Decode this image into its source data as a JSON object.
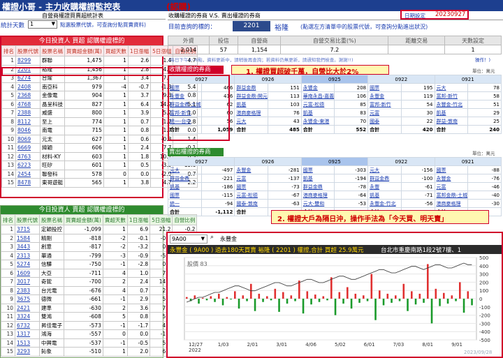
{
  "title_bar": {
    "title": "權證小哥 - 主力收購權證監控表",
    "badge": "(認購)",
    "date_label": "日期設定",
    "date_value": "20230927"
  },
  "left_top": {
    "caption": "自營商權證買賣超統計表",
    "days_label": "統計天數",
    "days_value": "1",
    "hint": "點選股票代號，可查詢分點買賣資料)"
  },
  "right_top": {
    "caption": "收購權證的券商 V.S. 賣出權證的券商",
    "query_label": "目前查詢的標的：",
    "stock_code": "2201",
    "stock_name": "裕隆",
    "hint": "(點選左方清單中的股票代號，可查詢分點進出狀況)"
  },
  "summary": {
    "headers": [
      "外資",
      "投信",
      "自營商",
      "自營交易比重(%)",
      "距離交易",
      "天數設定"
    ],
    "values": [
      "2,014",
      "57",
      "1,154",
      "7.2",
      "",
      "1"
    ],
    "note": "(每日下午4~6點，資料更新中，請稍後再查詢；若資料仍無更新，請通知我們檢查。謝謝!!)",
    "note_tail": "操作！)"
  },
  "buy_table": {
    "title": "今日投資人 買超 認購權證標的",
    "headers": [
      "排名",
      "股票代號",
      "股票名稱",
      "買賣超金額(萬)",
      "買超天數",
      "1日漲幅",
      "5日漲幅",
      "自營比例"
    ],
    "rows": [
      [
        "1",
        "8299",
        "群聯",
        "1,475",
        "1",
        "2.6",
        "1.4",
        "4.7"
      ],
      [
        "2",
        "2201",
        "裕隆",
        "1,456",
        "1",
        "2.8",
        "4.6",
        "7.2"
      ],
      [
        "3",
        "6274",
        "台燿",
        "1,367",
        "1",
        "3.4",
        "7.5",
        "0.8"
      ],
      [
        "4",
        "2408",
        "南亞科",
        "979",
        "-4",
        "-0.7",
        "-1.3",
        "5.4"
      ],
      [
        "5",
        "2368",
        "金像電",
        "904",
        "1",
        "3.7",
        "9.3",
        "0.8"
      ],
      [
        "6",
        "4768",
        "晶呈科技",
        "827",
        "1",
        "6.4",
        "14.9",
        "5.1"
      ],
      [
        "7",
        "2388",
        "威盛",
        "800",
        "1",
        "3.9",
        "5.2",
        "1.0"
      ],
      [
        "8",
        "8112",
        "至上",
        "774",
        "1",
        "0.7",
        "1.7",
        "2.8"
      ],
      [
        "9",
        "8046",
        "南電",
        "715",
        "1",
        "0.8",
        "1.7",
        "0.0"
      ],
      [
        "10",
        "8069",
        "元太",
        "627",
        "1",
        "0.6",
        "-0.8",
        "1.4"
      ],
      [
        "11",
        "6669",
        "緯穎",
        "606",
        "1",
        "2.4",
        "7.7",
        "-0.1"
      ],
      [
        "12",
        "4763",
        "材料-KY",
        "603",
        "1",
        "1.8",
        "10.2",
        "0.3"
      ],
      [
        "13",
        "6223",
        "旺矽",
        "601",
        "1",
        "0.5",
        "-3.3",
        "-15.6"
      ],
      [
        "14",
        "2454",
        "聯發科",
        "578",
        "0",
        "0.0",
        "-2.9",
        "0.7"
      ],
      [
        "15",
        "8478",
        "東哥遊艇",
        "565",
        "1",
        "3.8",
        "4.7",
        "2.2"
      ]
    ]
  },
  "sell_table": {
    "title": "今日投資人 賣超 認購權證標的",
    "headers": [
      "排名",
      "股票代號",
      "股票名稱",
      "買賣超金額(萬)",
      "賣超天數",
      "1日漲幅",
      "5日漲幅",
      "自營比例"
    ],
    "rows": [
      [
        "1",
        "3715",
        "定穎投控",
        "-1,099",
        "1",
        "6.9",
        "21.2",
        "-0.2"
      ],
      [
        "2",
        "1584",
        "精剛",
        "-818",
        "-2",
        "-0.1",
        "-0.8",
        "-6.4"
      ],
      [
        "3",
        "3443",
        "創意",
        "-817",
        "-2",
        "-3.2",
        "0.0",
        "-0.5"
      ],
      [
        "4",
        "2313",
        "華通",
        "-799",
        "-3",
        "-0.9",
        "-5.0",
        "-3.4"
      ],
      [
        "5",
        "5274",
        "信驊",
        "-750",
        "-1",
        "-2.8",
        "0.2",
        "-2.5"
      ],
      [
        "6",
        "1609",
        "大亞",
        "-711",
        "4",
        "1.0",
        "7.6",
        "-2.3"
      ],
      [
        "7",
        "3017",
        "奇鋐",
        "-700",
        "2",
        "2.4",
        "14.2",
        "0.1"
      ],
      [
        "8",
        "2383",
        "台光電",
        "-676",
        "4",
        "0.7",
        "2.8",
        "-0.3"
      ],
      [
        "9",
        "3675",
        "德微",
        "-661",
        "-1",
        "2.9",
        "5.9",
        "-2.6"
      ],
      [
        "10",
        "2421",
        "建準",
        "-630",
        "2",
        "3.6",
        "7.0",
        "-0.3"
      ],
      [
        "11",
        "3324",
        "雙鴻",
        "-608",
        "5",
        "0.8",
        "5.1",
        "-0.8"
      ],
      [
        "12",
        "6732",
        "昇佳電子",
        "-573",
        "-1",
        "-1.7",
        "4.2",
        "-2.1"
      ],
      [
        "13",
        "1317",
        "鴻海",
        "-557",
        "0",
        "0.0",
        "-1.9",
        "-0.3"
      ],
      [
        "14",
        "1513",
        "中興電",
        "-537",
        "-1",
        "-0.5",
        "5.5",
        "-1.2"
      ],
      [
        "15",
        "3293",
        "鈊象",
        "-510",
        "1",
        "2.0",
        "6.9",
        "-0.9"
      ]
    ]
  },
  "buy_brokers": {
    "title": "收購權證的券商",
    "unit": "單位：萬元",
    "dates": [
      "0927",
      "0926",
      "0925",
      "0922",
      "0921"
    ],
    "columns": [
      {
        "rows": [
          [
            "國票",
            "466"
          ],
          [
            "永豐金",
            "416"
          ],
          [
            "群益金鼎-土城",
            "62"
          ],
          [
            "富邦-新竹",
            "60"
          ],
          [
            "統一-台中",
            "56"
          ]
        ],
        "total": "1,059"
      },
      {
        "rows": [
          [
            "群益金鼎",
            "151"
          ],
          [
            "群益金鼎-開元",
            "113"
          ],
          [
            "凱基",
            "103"
          ],
          [
            "港商麥格理",
            "76"
          ],
          [
            "元大",
            "43"
          ]
        ],
        "total": "485"
      },
      {
        "rows": [
          [
            "永豐金",
            "208"
          ],
          [
            "華南永昌-嘉義",
            "106"
          ],
          [
            "元富-松德",
            "85"
          ],
          [
            "凱基",
            "83"
          ],
          [
            "永豐金-東港",
            "70"
          ]
        ],
        "total": "552"
      },
      {
        "rows": [
          [
            "國票",
            "195"
          ],
          [
            "永豐金",
            "119"
          ],
          [
            "富邦-新竹",
            "54"
          ],
          [
            "元富",
            "30"
          ],
          [
            "國泰",
            "22"
          ]
        ],
        "total": "420"
      },
      {
        "rows": [
          [
            "元大",
            "78"
          ],
          [
            "富邦-新竹",
            "58"
          ],
          [
            "永豐金-竹北",
            "51"
          ],
          [
            "凱基",
            "29"
          ],
          [
            "群益-敦南",
            "25"
          ]
        ],
        "total": "240"
      }
    ],
    "total_label": "合計"
  },
  "sell_brokers": {
    "title": "賣出權證的券商",
    "unit": "單位：萬元",
    "dates": [
      "0927",
      "0926",
      "0925",
      "0922",
      "0921"
    ],
    "columns": [
      {
        "rows": [
          [
            "元大",
            "-497"
          ],
          [
            "群益金鼎",
            "-221"
          ],
          [
            "凱基",
            "-186"
          ],
          [
            "國票",
            "-115"
          ],
          [
            "統一",
            "-94"
          ]
        ],
        "total": "-1,112"
      },
      {
        "rows": [
          [
            "永豐金",
            "-281"
          ],
          [
            "元富",
            "-137"
          ],
          [
            "國票",
            "-73"
          ],
          [
            "元富-松德",
            "-67"
          ],
          [
            "國泰-敦南",
            "-63"
          ]
        ],
        "total": ""
      },
      {
        "rows": [
          [
            "國票",
            "-303"
          ],
          [
            "凱基",
            "-194"
          ],
          [
            "群益金鼎",
            "-78"
          ],
          [
            "港商麥格理",
            "-64"
          ],
          [
            "元大-雙和",
            "-53"
          ]
        ],
        "total": ""
      },
      {
        "rows": [
          [
            "元大",
            "-156"
          ],
          [
            "群益金鼎",
            "-100"
          ],
          [
            "永豐",
            "-61"
          ],
          [
            "凱基",
            "-71"
          ],
          [
            "永豐金-竹北",
            "-56"
          ]
        ],
        "total": ""
      },
      {
        "rows": [
          [
            "國票",
            "-88"
          ],
          [
            "永豐金",
            "-76"
          ],
          [
            "元富",
            "-46"
          ],
          [
            "富邦金鼎-土城",
            "-40"
          ],
          [
            "港商麥格理",
            "-30"
          ]
        ],
        "total": ""
      }
    ],
    "total_label": "合計"
  },
  "callouts": {
    "one": "1. 權證買超破千萬，自營比大於2%",
    "two": "2. 權證大戶為隔日沖，操作手法為「今天買、明天賣」"
  },
  "chart_panel": {
    "broker_code": "9A00",
    "broker_name": "永豐金",
    "heading": "永豐金 ( 9A00 ) 過去180天買賣 裕隆 ( 2201 ) 權證,合計 買超 25.9萬元",
    "address": "台北市重慶南路1段2號7樓、1",
    "price_label": "股價 83",
    "watermark_date": "2023/09/28"
  },
  "chart_data": {
    "type": "bar",
    "title": "永豐金 ( 9A00 ) 過去180天買賣 裕隆 ( 2201 ) 權證,合計 買超 25.9萬元",
    "x_ticks": [
      "12/27\n2022",
      "1/03",
      "2/01",
      "3/01",
      "4/06",
      "5/02",
      "6/01",
      "7/03",
      "8/01",
      "9/01"
    ],
    "y_right_ticks": [
      500,
      400,
      300,
      200,
      100,
      0,
      -100,
      -200,
      -300,
      -400,
      -500
    ],
    "ylim": [
      -500,
      500
    ],
    "grid": true,
    "series": [
      {
        "name": "買賣超",
        "values": [
          20,
          -30,
          40,
          -60,
          10,
          -20,
          30,
          -40,
          60,
          -80,
          20,
          -10,
          90,
          -120,
          40,
          -30,
          180,
          -150,
          60,
          -40,
          30,
          -20,
          120,
          -160,
          80,
          -60,
          40,
          -30,
          220,
          -180,
          90,
          -70,
          50,
          -40,
          30,
          -20,
          260,
          -200,
          80,
          -60,
          140,
          -120,
          60,
          -50,
          40,
          -30,
          300,
          -260,
          100,
          -80,
          60,
          -50,
          40,
          -30,
          180,
          -150,
          90,
          -70,
          60,
          -50,
          420,
          -300,
          120,
          -90,
          70,
          -60,
          40,
          -30,
          200,
          -170,
          90,
          -80
        ]
      },
      {
        "name": "股價",
        "values": [
          60,
          61,
          62,
          63,
          63,
          64,
          65,
          66,
          66,
          67,
          68,
          69,
          70,
          70,
          69,
          68,
          67,
          67,
          68,
          69,
          70,
          71,
          72,
          72,
          71,
          70,
          70,
          71,
          72,
          73,
          74,
          74,
          73,
          72,
          72,
          73,
          74,
          75,
          76,
          76,
          75,
          74,
          74,
          75,
          76,
          77,
          78,
          79,
          80,
          80,
          79,
          78,
          78,
          79,
          80,
          81,
          82,
          82,
          81,
          80,
          81,
          82,
          83,
          83,
          82,
          81,
          81,
          82,
          83,
          84,
          83,
          83
        ]
      }
    ]
  }
}
